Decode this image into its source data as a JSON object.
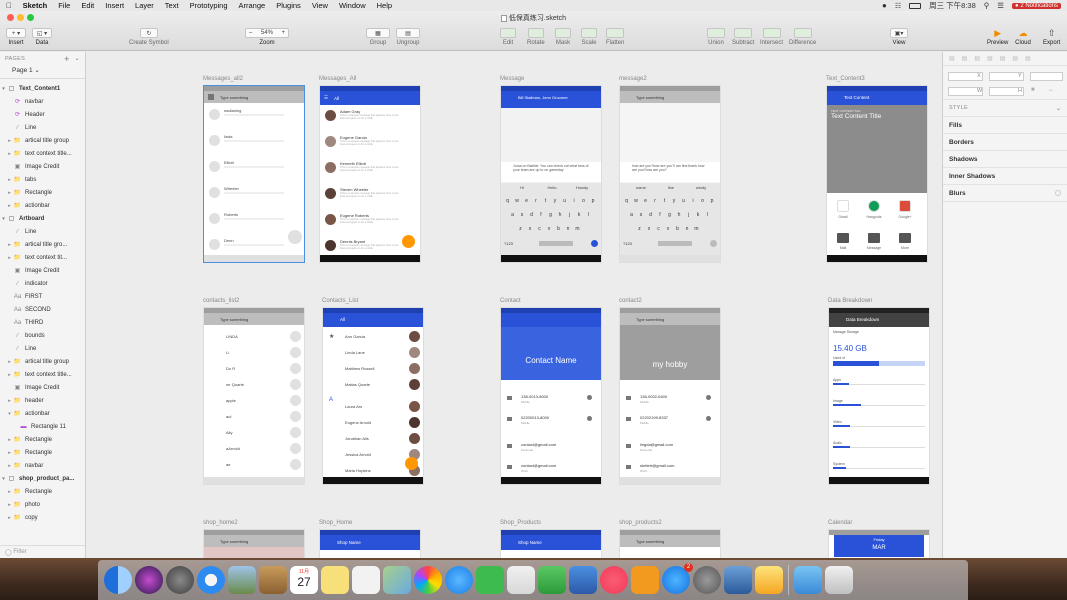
{
  "menubar": {
    "app": "Sketch",
    "items": [
      "File",
      "Edit",
      "Insert",
      "Layer",
      "Text",
      "Prototyping",
      "Arrange",
      "Plugins",
      "View",
      "Window",
      "Help"
    ],
    "clock": "周三 下午8:38",
    "notifications": "2 Notifications"
  },
  "window": {
    "title": "低保真练习.sketch"
  },
  "toolbar": {
    "insert": "Insert",
    "data": "Data",
    "create_symbol": "Create Symbol",
    "zoom_label": "Zoom",
    "zoom_value": "54%",
    "group": "Group",
    "ungroup": "Ungroup",
    "edit": "Edit",
    "rotate": "Rotate",
    "mask": "Mask",
    "scale": "Scale",
    "flatten": "Flatten",
    "union": "Union",
    "subtract": "Subtract",
    "intersect": "Intersect",
    "difference": "Difference",
    "view": "View",
    "preview": "Preview",
    "cloud": "Cloud",
    "export": "Export"
  },
  "pages": {
    "header": "PAGES",
    "current": "Page 1"
  },
  "layers": [
    {
      "name": "Text_Content1",
      "level": 0,
      "type": "artboard",
      "expanded": true
    },
    {
      "name": "navbar",
      "level": 1,
      "type": "symbol"
    },
    {
      "name": "Header",
      "level": 1,
      "type": "symbol"
    },
    {
      "name": "Line",
      "level": 1,
      "type": "line"
    },
    {
      "name": "artical title group",
      "level": 1,
      "type": "group"
    },
    {
      "name": "text context title...",
      "level": 1,
      "type": "group"
    },
    {
      "name": "Image Credit",
      "level": 1,
      "type": "rect"
    },
    {
      "name": "tabs",
      "level": 1,
      "type": "group"
    },
    {
      "name": "Rectangle",
      "level": 1,
      "type": "group"
    },
    {
      "name": "actionbar",
      "level": 1,
      "type": "group"
    },
    {
      "name": "Artboard",
      "level": 0,
      "type": "artboard",
      "expanded": true
    },
    {
      "name": "Line",
      "level": 1,
      "type": "line"
    },
    {
      "name": "artical title gro...",
      "level": 1,
      "type": "group"
    },
    {
      "name": "text context tit...",
      "level": 1,
      "type": "group"
    },
    {
      "name": "Image Credit",
      "level": 1,
      "type": "rect"
    },
    {
      "name": "indicator",
      "level": 1,
      "type": "line"
    },
    {
      "name": "FIRST",
      "level": 1,
      "type": "text"
    },
    {
      "name": "SECOND",
      "level": 1,
      "type": "text"
    },
    {
      "name": "THIRD",
      "level": 1,
      "type": "text"
    },
    {
      "name": "bounds",
      "level": 1,
      "type": "line"
    },
    {
      "name": "Line",
      "level": 1,
      "type": "line"
    },
    {
      "name": "artical title group",
      "level": 1,
      "type": "group"
    },
    {
      "name": "text context title...",
      "level": 1,
      "type": "group"
    },
    {
      "name": "Image Credit",
      "level": 1,
      "type": "rect"
    },
    {
      "name": "header",
      "level": 1,
      "type": "group"
    },
    {
      "name": "actionbar",
      "level": 1,
      "type": "group",
      "expanded": true
    },
    {
      "name": "Rectangle 11",
      "level": 2,
      "type": "shape"
    },
    {
      "name": "Rectangle",
      "level": 1,
      "type": "group"
    },
    {
      "name": "Rectangle",
      "level": 1,
      "type": "group"
    },
    {
      "name": "navbar",
      "level": 1,
      "type": "group"
    },
    {
      "name": "shop_product_pa...",
      "level": 0,
      "type": "artboard",
      "expanded": true
    },
    {
      "name": "Rectangle",
      "level": 1,
      "type": "group"
    },
    {
      "name": "photo",
      "level": 1,
      "type": "group"
    },
    {
      "name": "copy",
      "level": 1,
      "type": "group"
    }
  ],
  "filter_placeholder": "Filter",
  "inspector": {
    "x": "X",
    "y": "Y",
    "w": "W",
    "h": "H",
    "style": "STYLE",
    "fills": "Fills",
    "borders": "Borders",
    "shadows": "Shadows",
    "inner_shadows": "Inner Shadows",
    "blurs": "Blurs"
  },
  "artboards": {
    "messages_all2": {
      "name": "Messages_all2",
      "search": "Type something",
      "contacts": [
        "nadianing",
        "linda",
        "Elliott",
        "Wheeler",
        "Roberts",
        "Denn"
      ]
    },
    "messages_all": {
      "name": "Messages_All",
      "title": "All",
      "contacts": [
        "Adam Gray",
        "Eugene Garcia",
        "Kenneth Elliott",
        "Steven Wheeler",
        "Eugene Roberts",
        "Dennis Bryant"
      ],
      "preview": "This is a sample message that appears here in two lines and goes on for a while"
    },
    "message": {
      "name": "Message",
      "header": "Bill Stallman, Jenn Groomer",
      "bubble": "Juma on Babble: You can check out what fans of your team are up to on gameday",
      "suggestions": [
        "Hi",
        "Hello",
        "Howdy"
      ],
      "keys1": [
        "q",
        "w",
        "e",
        "r",
        "t",
        "y",
        "u",
        "i",
        "o",
        "p"
      ],
      "keys2": [
        "a",
        "s",
        "d",
        "f",
        "g",
        "h",
        "j",
        "k",
        "l"
      ],
      "keys3": [
        "z",
        "x",
        "c",
        "v",
        "b",
        "n",
        "m"
      ],
      "sym": "?123"
    },
    "message2": {
      "name": "message2",
      "search": "Type something",
      "bubble": "how are you?how are you?I am fine,thank how are you?how are you?",
      "suggestions": [
        "name",
        "line",
        "windy"
      ]
    },
    "text_content3": {
      "name": "Text_Content3",
      "bar_title": "Text Content",
      "caption": "TEXT CONTENT TAG",
      "heading": "Text Content Title",
      "apps": [
        "Gmail",
        "Hangouts",
        "Google+"
      ],
      "apps2": [
        "Mail",
        "Message",
        "More"
      ]
    },
    "contacts_list2": {
      "name": "contacts_list2",
      "search": "Type something",
      "items": [
        "LINDA",
        "Li",
        "Du R",
        "mr Quarte",
        "apple",
        "aul",
        "Ally",
        "aArnold",
        "ae"
      ]
    },
    "contacts_list": {
      "name": "Contacts_List",
      "title": "All",
      "items": [
        "Ann Garcia",
        "Linda Lane",
        "Matthew Russell",
        "Matias Quarte",
        "Laura Ars",
        "Eugene Arnold",
        "Jonathan Alls",
        "Jessica Arnold",
        "Maria Hopkins"
      ],
      "letter": "A"
    },
    "contact": {
      "name": "Contact",
      "contact_name": "Contact Name",
      "phone1": "138-0013-8000",
      "phone1_type": "Mobile",
      "phone2": "02200013-8000",
      "phone2_type": "Mobile",
      "email1": "contact@gmail.com",
      "email1_type": "Personal",
      "email2": "contact@gmail.com",
      "email2_type": "Work"
    },
    "contact2": {
      "name": "contact2",
      "search": "Type something",
      "hobby": "my hobby",
      "phone1": "136-0002-6400",
      "phone1_type": "Mobile",
      "phone2": "02202199-8337",
      "phone2_type": "Mobile",
      "email1": "lingda@gmail.com",
      "email1_type": "Personal",
      "email2": "skrttert@gmail.com",
      "email2_type": "Work"
    },
    "data_breakdown": {
      "name": "Data Breakdown",
      "bar_title": "Data Breakdown",
      "label": "Manage Storage",
      "total": "15.40 GB",
      "used": "Used of",
      "cats": [
        "Apps",
        "Image",
        "Video",
        "Audio",
        "System"
      ]
    },
    "shop_home2": {
      "name": "shop_home2",
      "search": "Type something"
    },
    "shop_home": {
      "name": "Shop_Home",
      "title": "Shop Name"
    },
    "shop_products": {
      "name": "Shop_Products",
      "title": "Shop Name"
    },
    "shop_products2": {
      "name": "shop_products2",
      "search": "Type something"
    },
    "calendar": {
      "name": "Calendar",
      "day": "Friday",
      "month": "MAR"
    }
  },
  "dock": {
    "apps": [
      "Finder",
      "Siri",
      "Launchpad",
      "Safari",
      "Preview",
      "Notes",
      "Calendar",
      "Stickies",
      "Reminders",
      "Maps",
      "Photos",
      "Messages",
      "FaceTime",
      "Keynote",
      "Numbers",
      "Keynote Presenter",
      "Music",
      "Books",
      "App Store",
      "System Preferences",
      "Xcode",
      "Sketch",
      "Downloads",
      "Trash"
    ],
    "calendar_day": "27",
    "calendar_month": "11月",
    "appstore_badge": "2"
  },
  "colors": {
    "material_blue": "#2a52d8",
    "material_orange": "#ff9800",
    "sketch_selection": "#4a90e2",
    "material_dark": "#424242"
  }
}
